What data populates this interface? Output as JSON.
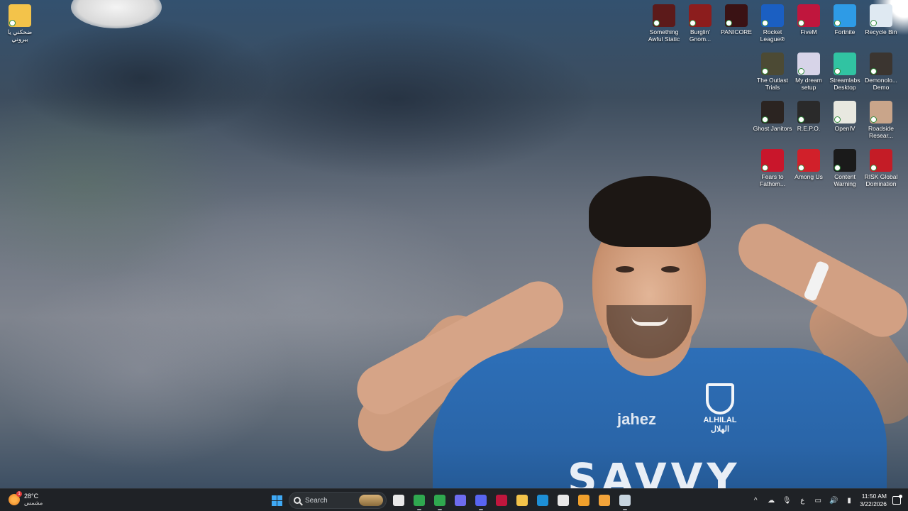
{
  "desktop": {
    "left_icons": [
      {
        "label": "ضحكني يا بيروني",
        "icon": "folder-icon",
        "color": "#f3c34a"
      }
    ],
    "right_icons": [
      {
        "label": "Something Awful Static",
        "icon": "game-icon",
        "color": "#5c1a1a"
      },
      {
        "label": "Burglin' Gnom...",
        "icon": "game-icon",
        "color": "#8c1d1d"
      },
      {
        "label": "PANICORE",
        "icon": "game-icon",
        "color": "#3a1214"
      },
      {
        "label": "Rocket League®",
        "icon": "rocket-league-icon",
        "color": "#1b5fc2"
      },
      {
        "label": "FiveM",
        "icon": "fivem-icon",
        "color": "#c0163d"
      },
      {
        "label": "Fortnite",
        "icon": "fortnite-icon",
        "color": "#2e9be6"
      },
      {
        "label": "Recycle Bin",
        "icon": "recycle-bin-icon",
        "color": "#dfe9f2"
      },
      {
        "label": "The Outlast Trials",
        "icon": "game-icon",
        "color": "#4c4a34"
      },
      {
        "label": "My dream setup",
        "icon": "image-icon",
        "color": "#d7d4e8"
      },
      {
        "label": "Streamlabs Desktop",
        "icon": "streamlabs-icon",
        "color": "#31c3a2"
      },
      {
        "label": "Demonolo... Demo",
        "icon": "game-icon",
        "color": "#3b3530"
      },
      {
        "label": "Ghost Janitors",
        "icon": "game-icon",
        "color": "#2b2421"
      },
      {
        "label": "R.E.P.O.",
        "icon": "game-icon",
        "color": "#2a2a2a"
      },
      {
        "label": "OpenIV",
        "icon": "openiv-icon",
        "color": "#e8e8e0"
      },
      {
        "label": "Roadside Resear...",
        "icon": "game-icon",
        "color": "#c9a58a"
      },
      {
        "label": "Fears to Fathom...",
        "icon": "game-icon",
        "color": "#c9162b"
      },
      {
        "label": "Among Us",
        "icon": "among-us-icon",
        "color": "#d1202a"
      },
      {
        "label": "Content Warning",
        "icon": "game-icon",
        "color": "#1a1a1a"
      },
      {
        "label": "RISK Global Domination",
        "icon": "game-icon",
        "color": "#c41c26"
      }
    ]
  },
  "wallpaper": {
    "jersey_text": "SAVVY",
    "sponsor_text": "jahez",
    "crest_text": "ALHILAL\nالهلال"
  },
  "taskbar": {
    "weather": {
      "temp": "28°C",
      "condition": "مشمس",
      "alert": "1"
    },
    "search_placeholder": "Search",
    "apps": [
      {
        "name": "file-explorer-icon",
        "color": "#e8e8e8",
        "running": false
      },
      {
        "name": "chrome-icon",
        "color": "#2fa84f",
        "running": true
      },
      {
        "name": "chrome-icon",
        "color": "#2fa84f",
        "running": true
      },
      {
        "name": "copilot-icon",
        "color": "#6e6cf0",
        "running": false
      },
      {
        "name": "discord-icon",
        "color": "#5865f2",
        "running": true
      },
      {
        "name": "fivem-icon",
        "color": "#c0163d",
        "running": false
      },
      {
        "name": "folder-icon",
        "color": "#f3c34a",
        "running": false
      },
      {
        "name": "edge-icon",
        "color": "#1d8fd6",
        "running": false
      },
      {
        "name": "store-icon",
        "color": "#e8e8e8",
        "running": false
      },
      {
        "name": "brave-icon",
        "color": "#f0a02c",
        "running": false
      },
      {
        "name": "chat-icon",
        "color": "#f3a43a",
        "running": false
      },
      {
        "name": "steam-icon",
        "color": "#c7d5e0",
        "running": true
      }
    ],
    "tray": {
      "chevron": "^",
      "language": "ع",
      "time": "11:50 AM",
      "date": "3/22/2026"
    }
  }
}
